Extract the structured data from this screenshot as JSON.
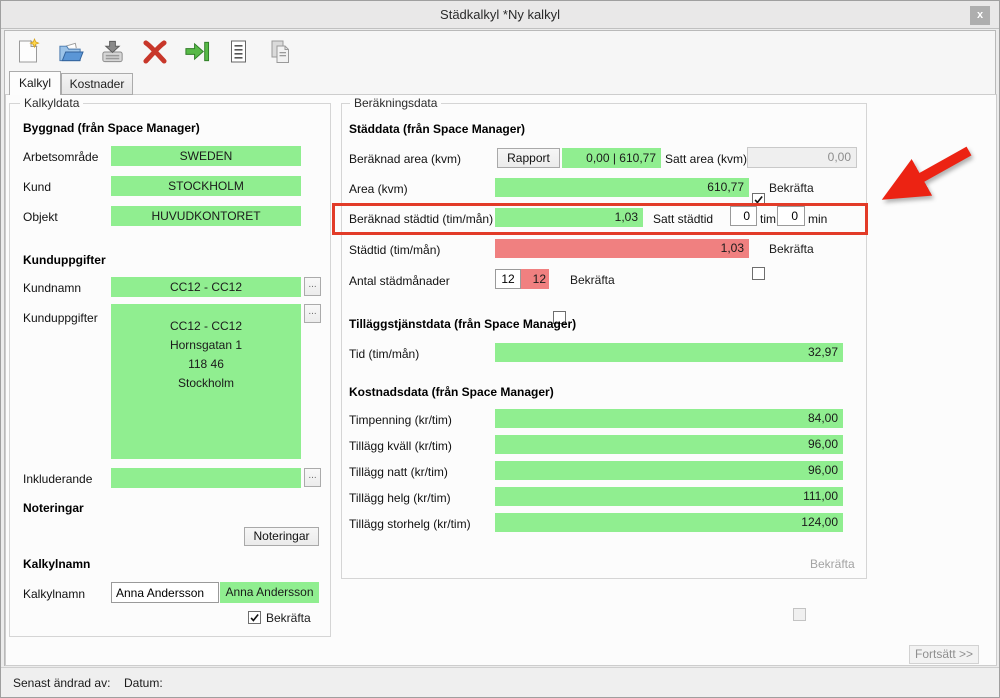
{
  "window": {
    "title": "Städkalkyl *Ny kalkyl",
    "close_label": "x"
  },
  "toolbar": {
    "icons": [
      "new-document",
      "open-folder",
      "save",
      "delete",
      "export",
      "report",
      "copy"
    ]
  },
  "tabs": {
    "kalkyl": "Kalkyl",
    "kostnader": "Kostnader"
  },
  "kalkyldata": {
    "legend": "Kalkyldata",
    "byggnad": {
      "heading": "Byggnad (från Space Manager)",
      "arbetsomrade": {
        "label": "Arbetsområde",
        "value": "SWEDEN"
      },
      "kund": {
        "label": "Kund",
        "value": "STOCKHOLM"
      },
      "objekt": {
        "label": "Objekt",
        "value": "HUVUDKONTORET"
      }
    },
    "kunduppgifter_section": {
      "heading": "Kunduppgifter",
      "kundnamn": {
        "label": "Kundnamn",
        "value": "CC12 - CC12",
        "more": "..."
      },
      "kunduppgifter": {
        "label": "Kunduppgifter",
        "lines": [
          "CC12 - CC12",
          "Hornsgatan 1",
          "118 46",
          "Stockholm"
        ],
        "more": "..."
      },
      "inkluderande": {
        "label": "Inkluderande",
        "value": "",
        "more": "..."
      }
    },
    "noteringar": {
      "heading": "Noteringar",
      "button_label": "Noteringar"
    },
    "kalkylnamn": {
      "heading": "Kalkylnamn",
      "label": "Kalkylnamn",
      "input_value": "Anna Andersson",
      "confirmed_value": "Anna Andersson",
      "bekrafta_label": "Bekräfta"
    }
  },
  "berakningsdata": {
    "legend": "Beräkningsdata",
    "staddata": {
      "heading": "Städdata (från Space Manager)",
      "beraknad_area": {
        "label": "Beräknad area (kvm)",
        "rapport_button": "Rapport",
        "value": "0,00 | 610,77",
        "satt_area_label": "Satt area (kvm)",
        "satt_area_value": "0,00"
      },
      "area": {
        "label": "Area (kvm)",
        "value": "610,77",
        "bekrafta_label": "Bekräfta"
      },
      "beraknad_stadtid": {
        "label": "Beräknad städtid (tim/mån)",
        "value": "1,03",
        "satt_stadtid_label": "Satt städtid",
        "tim_value": "0",
        "tim_label": "tim",
        "min_value": "0",
        "min_label": "min"
      },
      "stadtid": {
        "label": "Städtid (tim/mån)",
        "value": "1,03",
        "bekrafta_label": "Bekräfta"
      },
      "antal_stadmanader": {
        "label": "Antal städmånader",
        "input_value": "12",
        "value": "12",
        "bekrafta_label": "Bekräfta"
      }
    },
    "tillaggstjanst": {
      "heading": "Tilläggstjänstdata (från Space Manager)",
      "tid": {
        "label": "Tid (tim/mån)",
        "value": "32,97"
      }
    },
    "kostnadsdata": {
      "heading": "Kostnadsdata (från Space Manager)",
      "rows": [
        {
          "label": "Timpenning (kr/tim)",
          "value": "84,00"
        },
        {
          "label": "Tillägg kväll (kr/tim)",
          "value": "96,00"
        },
        {
          "label": "Tillägg natt (kr/tim)",
          "value": "96,00"
        },
        {
          "label": "Tillägg helg (kr/tim)",
          "value": "111,00"
        },
        {
          "label": "Tillägg storhelg (kr/tim)",
          "value": "124,00"
        }
      ]
    },
    "bekrafta_disabled_label": "Bekräfta",
    "fortsatt_button": "Fortsätt >>"
  },
  "statusbar": {
    "senast_andrad": "Senast ändrad av:",
    "datum": "Datum:"
  },
  "colors": {
    "green": "#90EE90",
    "red_bar": "#F08080",
    "annotation_red": "#E23B28"
  }
}
